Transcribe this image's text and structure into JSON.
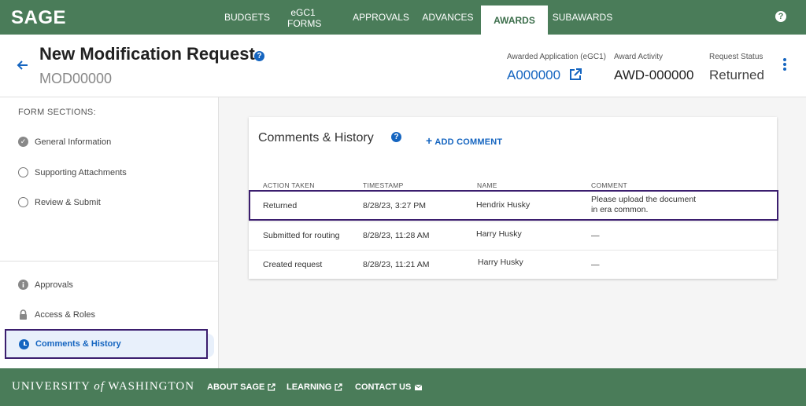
{
  "brand": {
    "logo": "SAGE"
  },
  "nav": {
    "items": [
      {
        "label": "BUDGETS"
      },
      {
        "label": "eGC1 FORMS"
      },
      {
        "label": "APPROVALS"
      },
      {
        "label": "ADVANCES"
      },
      {
        "label": "AWARDS"
      },
      {
        "label": "SUBAWARDS"
      }
    ],
    "active": "AWARDS",
    "help": "?"
  },
  "header": {
    "title": "New Modification Request",
    "subtitle": "MOD00000",
    "help": "?",
    "awarded_application_label": "Awarded Application (eGC1)",
    "awarded_application_value": "A000000",
    "award_activity_label": "Award Activity",
    "award_activity_value": "AWD-000000",
    "request_status_label": "Request Status",
    "request_status_value": "Returned"
  },
  "sidebar": {
    "heading": "FORM SECTIONS:",
    "sections": [
      {
        "label": "General Information",
        "icon": "check-circle-icon"
      },
      {
        "label": "Supporting Attachments",
        "icon": "empty-circle-icon"
      },
      {
        "label": "Review & Submit",
        "icon": "empty-circle-icon"
      }
    ],
    "extras": [
      {
        "label": "Approvals",
        "icon": "info-icon"
      },
      {
        "label": "Access & Roles",
        "icon": "lock-icon"
      }
    ],
    "active": {
      "label": "Comments & History",
      "icon": "clock-icon"
    }
  },
  "comments": {
    "title": "Comments & History",
    "help": "?",
    "add_label": "ADD COMMENT",
    "add_plus": "+",
    "columns": {
      "action": "ACTION TAKEN",
      "timestamp": "TIMESTAMP",
      "name": "NAME",
      "comment": "COMMENT"
    },
    "rows": [
      {
        "action": "Returned",
        "timestamp": "8/28/23, 3:27 PM",
        "name": "Hendrix Husky",
        "comment_line1": "Please upload the document",
        "comment_line2": "in era common."
      },
      {
        "action": "Submitted for routing",
        "timestamp": "8/28/23, 11:28 AM",
        "name": "Harry Husky",
        "comment_line1": "—",
        "comment_line2": ""
      },
      {
        "action": "Created request",
        "timestamp": "8/28/23, 11:21 AM",
        "name": "Harry Husky",
        "comment_line1": "—",
        "comment_line2": ""
      }
    ]
  },
  "footer": {
    "uw_part1": "UNIVERSITY",
    "uw_of": "of",
    "uw_part2": "WASHINGTON",
    "links": [
      {
        "label": "ABOUT SAGE"
      },
      {
        "label": "LEARNING"
      },
      {
        "label": "CONTACT US"
      }
    ]
  },
  "colors": {
    "brand_green": "#4a7c59",
    "link_blue": "#1565c0",
    "highlight_outline": "#3b1e6e",
    "active_bg": "#e8f0fb"
  }
}
